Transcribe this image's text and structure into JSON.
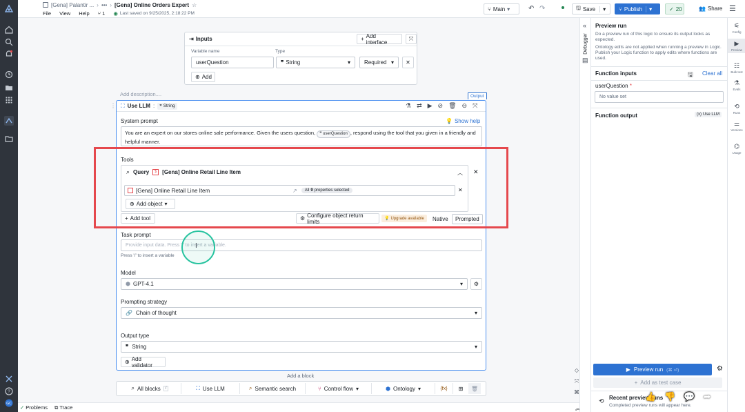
{
  "header": {
    "breadcrumb_parent": "[Gena] Palantir ...",
    "breadcrumb_more": "•••",
    "title": "[Gena] Online Orders Expert",
    "menu": [
      "File",
      "View",
      "Help"
    ],
    "branch_count": "1",
    "saved_status": "Last saved on 9/25/2025, 2:18:22 PM",
    "branch": "Main",
    "save_label": "Save",
    "publish_label": "Publish",
    "checks_count": "20",
    "share_label": "Share"
  },
  "inputs_card": {
    "title": "Inputs",
    "add_interface": "Add interface",
    "col_variable": "Variable name",
    "col_type": "Type",
    "variable_value": "userQuestion",
    "type_value": "String",
    "required_value": "Required",
    "add_label": "Add"
  },
  "llm_block": {
    "add_description": "Add description....",
    "output_tag": "Output",
    "title": "Use LLM",
    "type_suffix": "String",
    "system_prompt_label": "System prompt",
    "show_help": "Show help",
    "system_prompt_text_1": "You are an expert on our stores online sale performance. Given the users question,",
    "system_prompt_chip": "userQuestion",
    "system_prompt_text_2": ", respond using the tool that you given in a friendly and",
    "system_prompt_text_3": "helpful manner.",
    "tools_label": "Tools",
    "tool_query": "Query",
    "tool_object": "[Gena] Online Retail Line Item",
    "tool_row_object": "[Gena] Online Retail Line Item",
    "properties_prefix": "All",
    "properties_count": "9",
    "properties_suffix": "properties selected",
    "add_object": "Add object",
    "add_tool": "Add tool",
    "configure_limits": "Configure object return limits",
    "upgrade": "Upgrade available",
    "mode_native": "Native",
    "mode_prompted": "Prompted",
    "task_prompt_label": "Task prompt",
    "task_prompt_placeholder": "Provide input data. Press '/' to insert a variable.",
    "task_prompt_hint": "Press '/' to insert a variable",
    "model_label": "Model",
    "model_value": "GPT-4.1",
    "strategy_label": "Prompting strategy",
    "strategy_value": "Chain of thought",
    "output_type_label": "Output type",
    "output_type_value": "String",
    "add_validator": "Add validator"
  },
  "add_block": "Add a block",
  "block_toolbar": {
    "all_blocks": "All blocks",
    "all_blocks_key": "/",
    "use_llm": "Use LLM",
    "semantic_search": "Semantic search",
    "control_flow": "Control flow",
    "ontology": "Ontology",
    "fx": "{fx}"
  },
  "bottom": {
    "problems": "Problems",
    "trace": "Trace"
  },
  "debugger_label": "Debugger",
  "preview": {
    "title": "Preview run",
    "desc1": "Do a preview run of this logic to ensure its output looks as expected.",
    "desc2": "Ontology edits are not applied when running a preview in Logic. Publish your Logic function to apply edits where functions are used.",
    "inputs_title": "Function inputs",
    "clear_all": "Clear all",
    "input_name": "userQuestion",
    "input_required": "*",
    "input_placeholder": "No value set",
    "output_title": "Function output",
    "output_badge": "Use LLM",
    "run_label": "Preview run",
    "run_shortcut": "(⌘ ⏎)",
    "add_test_case": "Add as test case",
    "recent_title": "Recent preview runs",
    "recent_desc": "Completed preview runs will appear here."
  },
  "right_rail": [
    "Config",
    "Preview",
    "Bulk test",
    "Evals",
    "Runs",
    "Versions",
    "Usage"
  ],
  "colors": {
    "primary": "#2d72d2",
    "highlight": "#e5484d",
    "cursor": "#27c39f",
    "rail": "#2f343c"
  }
}
